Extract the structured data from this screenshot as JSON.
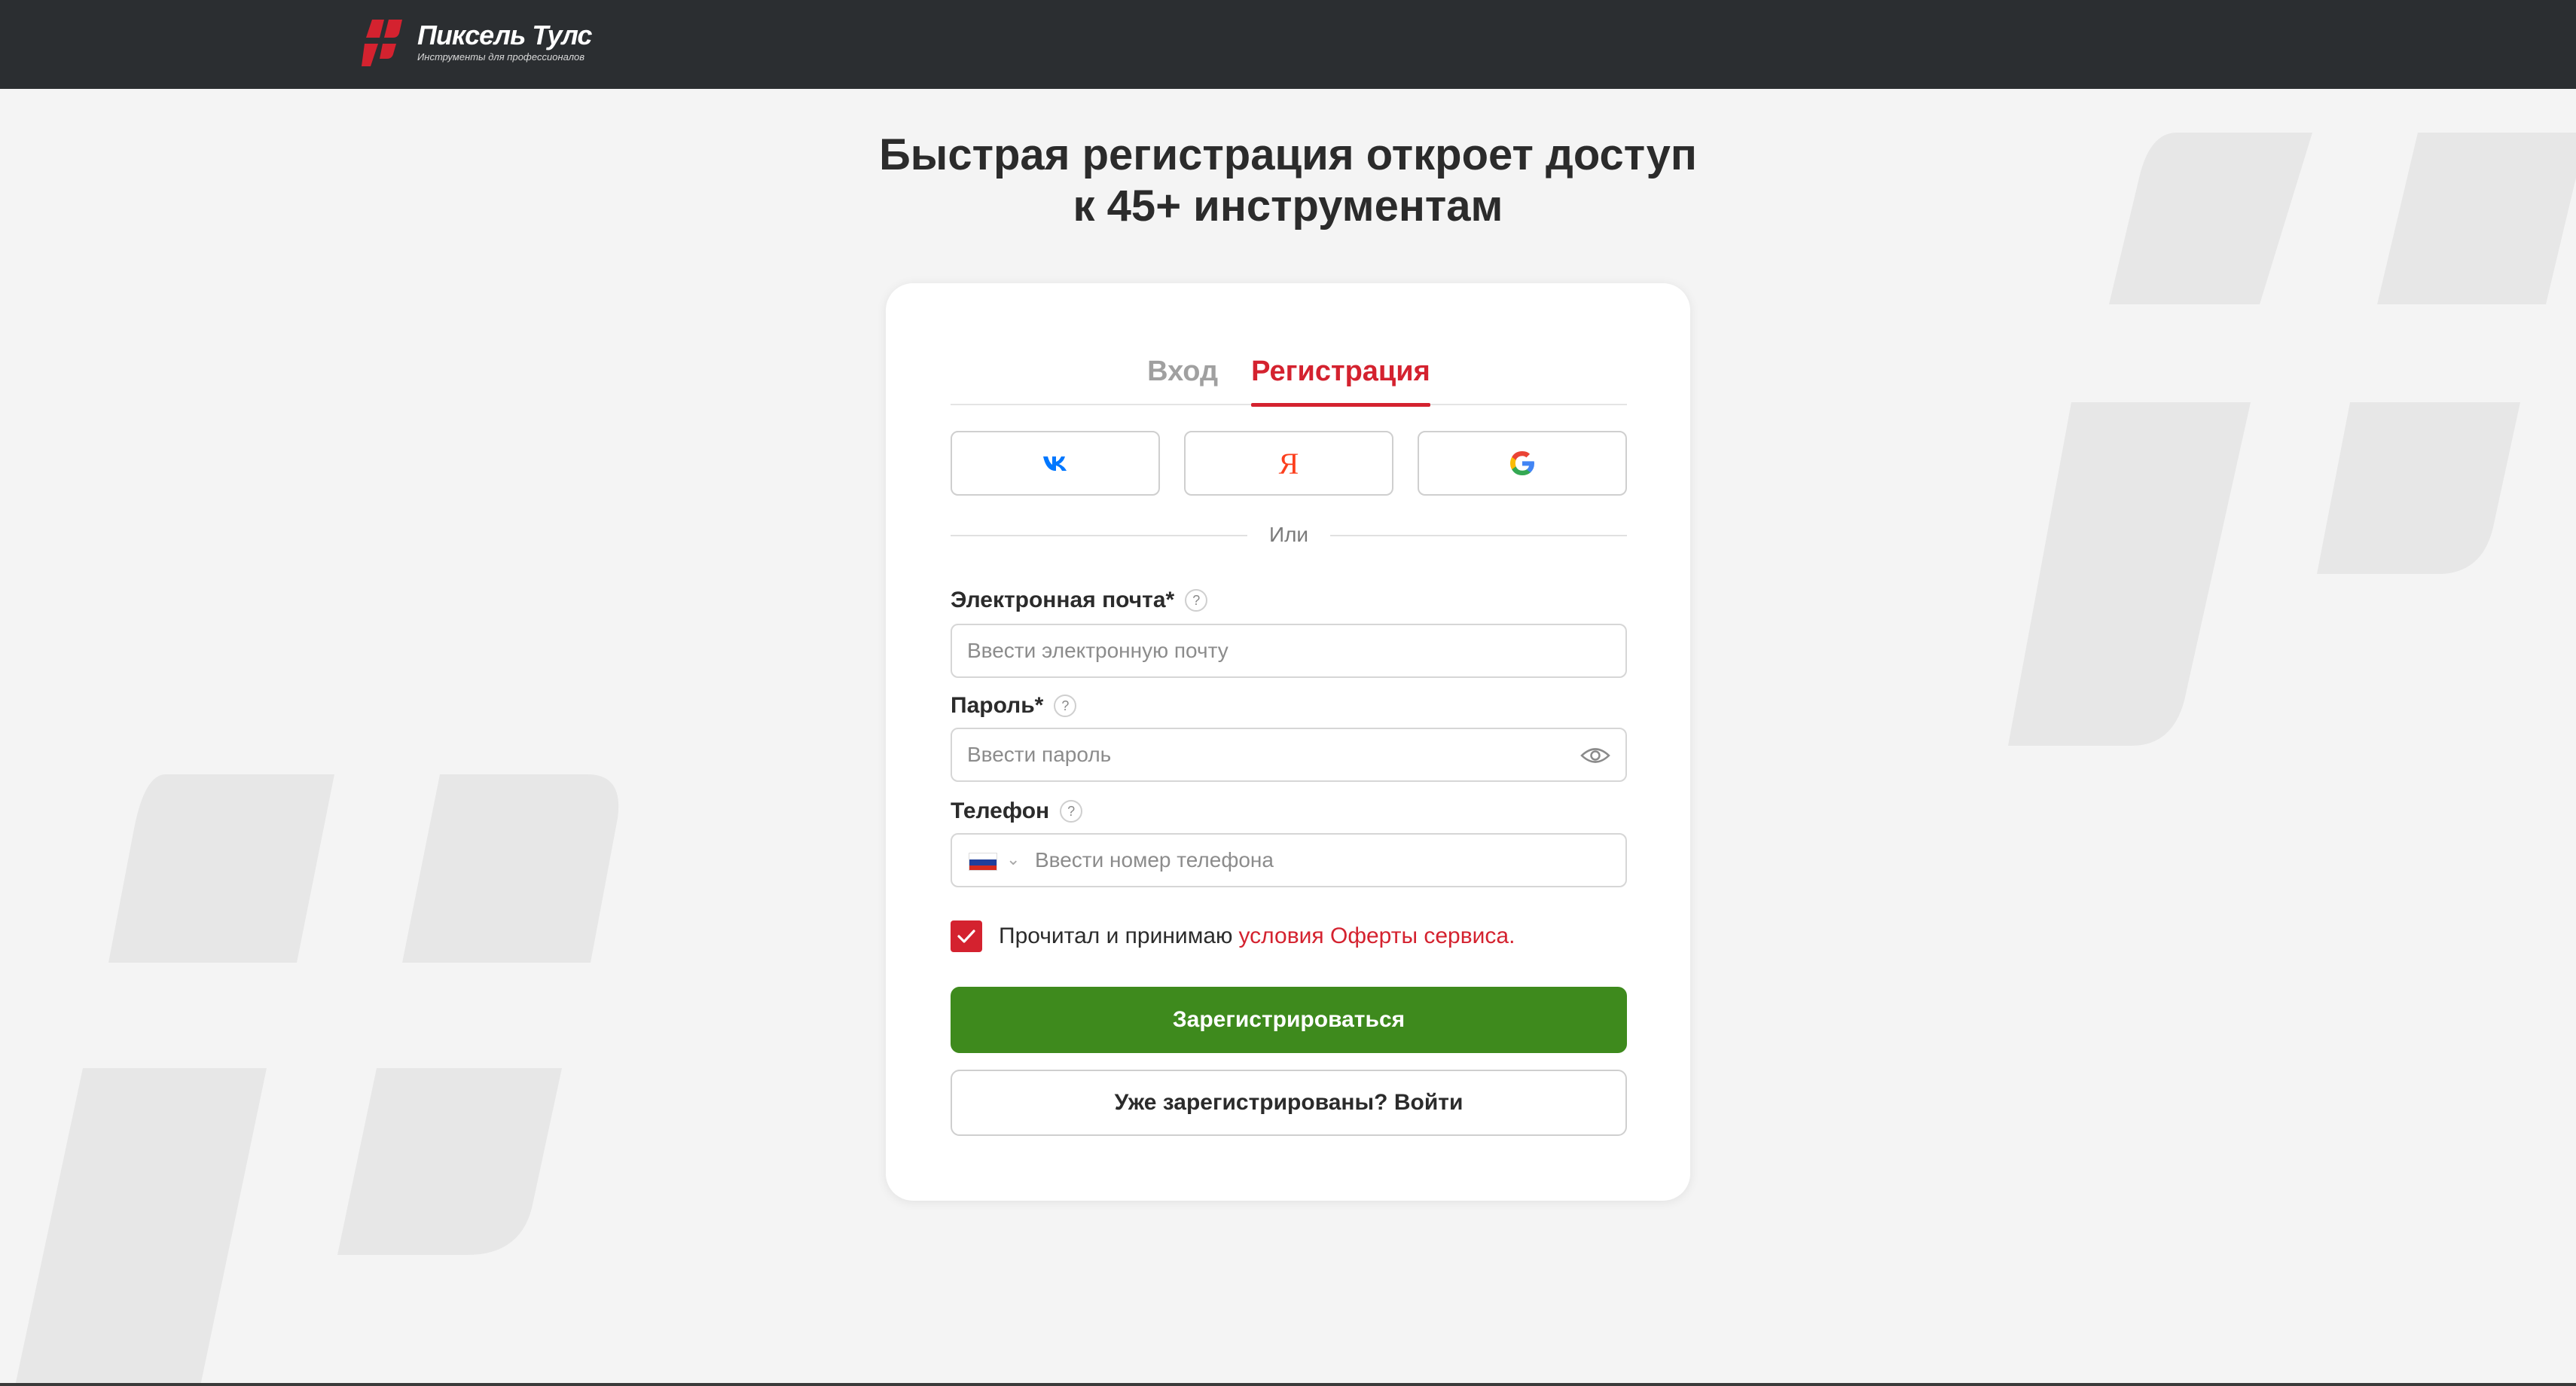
{
  "header": {
    "brand_name": "Пиксель Тулс",
    "brand_tagline": "Инструменты для профессионалов"
  },
  "hero": {
    "title_line1": "Быстрая регистрация откроет доступ",
    "title_line2": "к 45+ инструментам"
  },
  "tabs": [
    {
      "label": "Вход",
      "active": false
    },
    {
      "label": "Регистрация",
      "active": true
    }
  ],
  "social": {
    "vk_icon": "vk-icon",
    "yandex_icon": "yandex-icon",
    "yandex_glyph": "Я",
    "google_icon": "google-icon"
  },
  "divider_text": "Или",
  "form": {
    "email": {
      "label": "Электронная почта*",
      "placeholder": "Ввести электронную почту",
      "value": ""
    },
    "password": {
      "label": "Пароль*",
      "placeholder": "Ввести пароль",
      "value": ""
    },
    "phone": {
      "label": "Телефон",
      "placeholder": "Ввести номер телефона",
      "value": "",
      "country_flag": "russia-flag-icon"
    },
    "help_glyph": "?"
  },
  "consent": {
    "checked": true,
    "text": "Прочитал и принимаю",
    "link_text": "условия Оферты сервиса."
  },
  "buttons": {
    "register": "Зарегистрироваться",
    "login": "Уже зарегистрированы? Войти"
  },
  "colors": {
    "accent_red": "#d4222f",
    "primary_green": "#3e8a1d",
    "header_bg": "#2b2e31",
    "page_bg": "#f4f4f4"
  }
}
